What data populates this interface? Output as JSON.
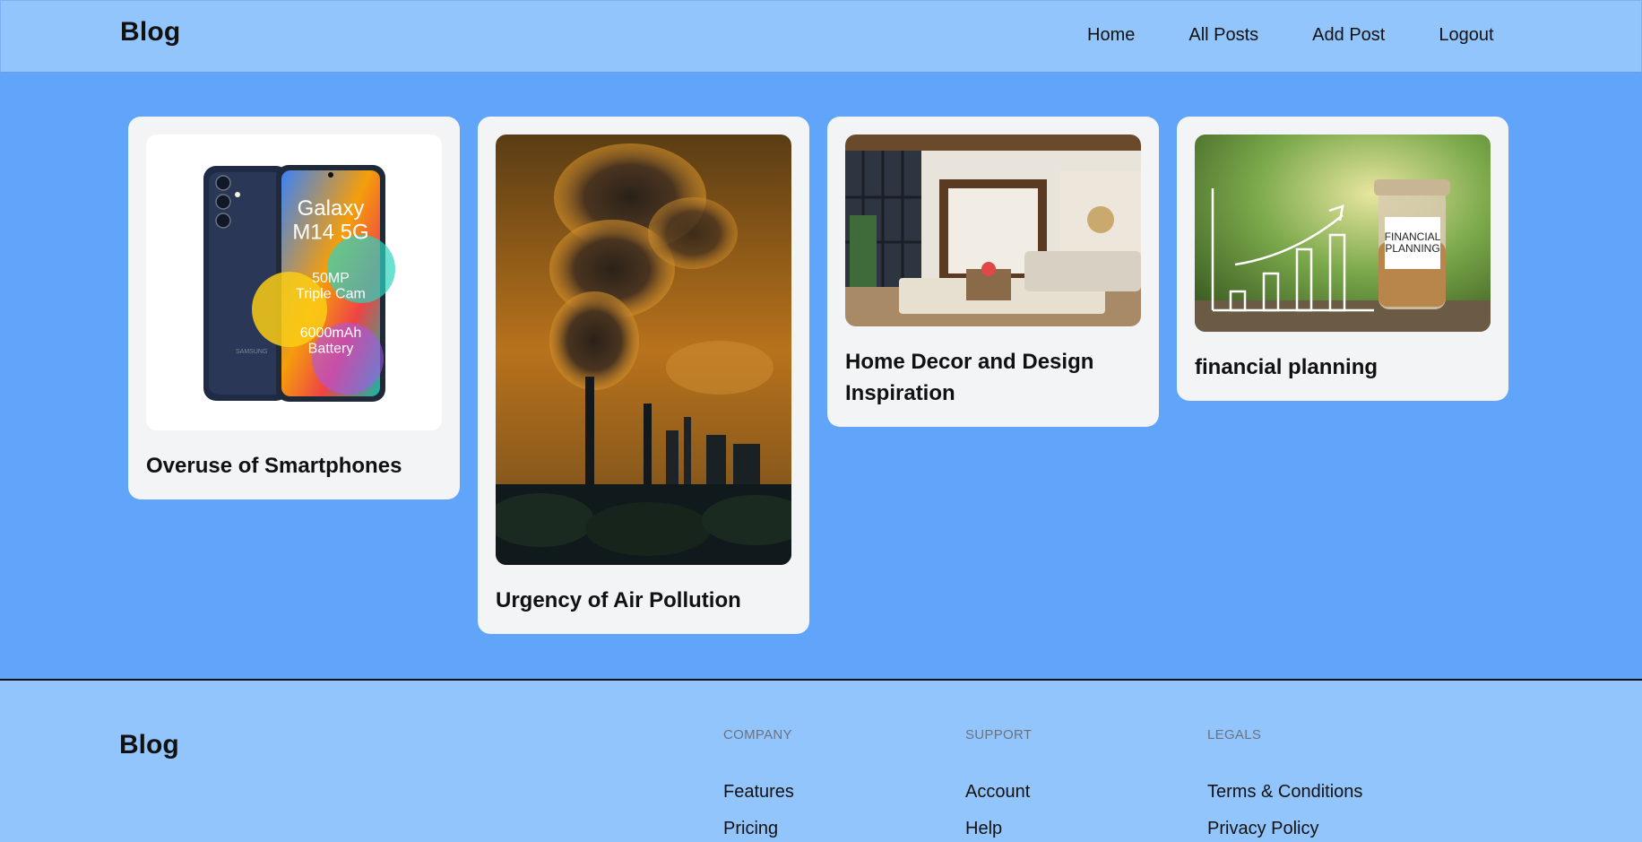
{
  "header": {
    "logo": "Blog",
    "nav": [
      "Home",
      "All Posts",
      "Add Post",
      "Logout"
    ]
  },
  "posts": [
    {
      "title": "Overuse of Smartphones",
      "image": "smartphone-photo"
    },
    {
      "title": "Urgency of Air Pollution",
      "image": "factory-smoke-photo"
    },
    {
      "title": "Home Decor and Design Inspiration",
      "image": "living-room-photo"
    },
    {
      "title": "financial planning",
      "image": "financial-planning-photo"
    }
  ],
  "phone_text": {
    "model": "Galaxy\nM14 5G",
    "cam": "50MP\nTriple Cam",
    "battery": "6000mAh\nBattery",
    "brand": "SAMSUNG"
  },
  "finance_text": {
    "jar_label": "FINANCIAL\nPLANNING"
  },
  "footer": {
    "logo": "Blog",
    "columns": [
      {
        "heading": "Company",
        "links": [
          "Features",
          "Pricing"
        ]
      },
      {
        "heading": "Support",
        "links": [
          "Account",
          "Help"
        ]
      },
      {
        "heading": "Legals",
        "links": [
          "Terms & Conditions",
          "Privacy Policy"
        ]
      }
    ]
  },
  "colors": {
    "page_bg": "#60a5fa",
    "header_bg": "#93c5fd",
    "card_bg": "#f3f4f6",
    "footer_heading": "#6b7280"
  }
}
